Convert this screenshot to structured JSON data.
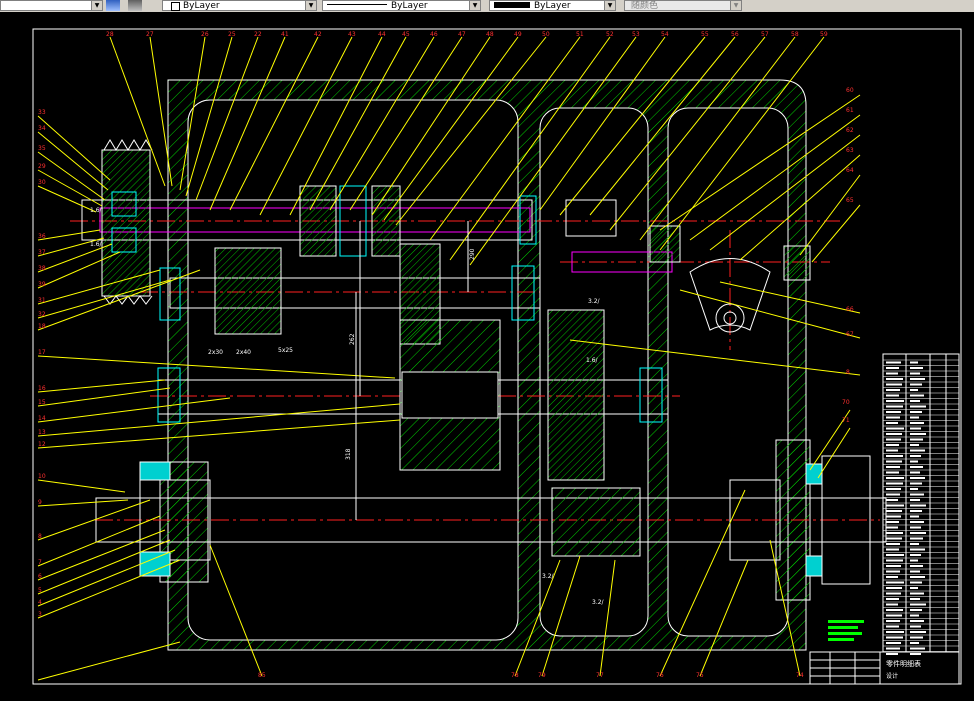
{
  "toolbar": {
    "layer_combo_arrow": "▼",
    "color_value": "ByLayer",
    "linetype_value": "ByLayer",
    "lineweight_value": "ByLayer",
    "plotstyle_value": "随颜色"
  },
  "drawing": {
    "dims": {
      "d_left_shaft_a": "1.6/",
      "d_left_shaft_b": "1.6/",
      "d_small_a": "2x30",
      "d_small_b": "2x40",
      "d_small_c": "5x25",
      "d_gear_roughness": "3.2/",
      "d_right_gear": "1.6/",
      "d_vert_1": "318",
      "d_vert_2": "262",
      "d_vert_3": "290",
      "d_bottom_1": "3.2/",
      "d_bottom_2": "3.2/"
    }
  },
  "title_block": {
    "heading": "零件明细表",
    "caption": "设计"
  },
  "colors": {
    "background": "#000000",
    "housing": "#00ff00",
    "outline": "#ffffff",
    "center_line": "#ff0000",
    "leader": "#ffff00",
    "shaft_line": "#ff00ff",
    "bearing": "#00ffff",
    "toolbar": "#d4d0c8"
  }
}
